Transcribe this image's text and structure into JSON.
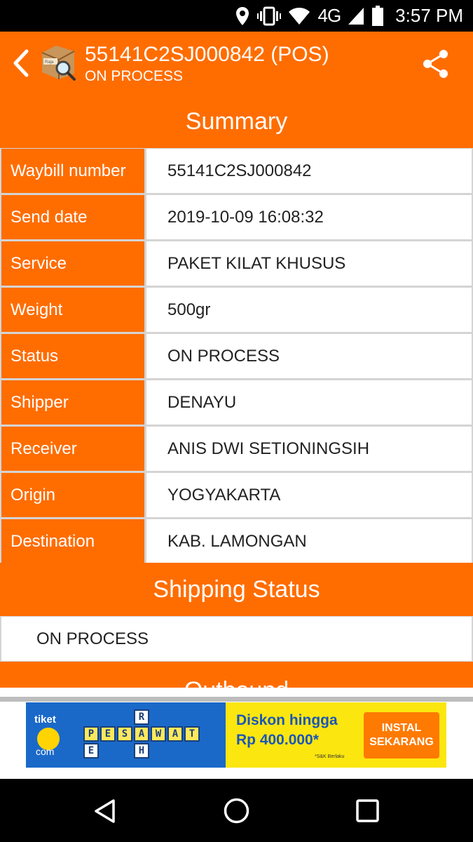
{
  "status_bar": {
    "network": "4G",
    "time": "3:57 PM",
    "icons": [
      "location-icon",
      "vibrate-icon",
      "wifi-icon",
      "signal-icon",
      "battery-icon"
    ]
  },
  "app_bar": {
    "title": "55141C2SJ000842 (POS)",
    "subtitle": "ON PROCESS",
    "back_icon": "chevron-left-icon",
    "app_icon": "parcel-search-icon",
    "app_icon_text": "Raja",
    "share_icon": "share-icon"
  },
  "summary": {
    "heading": "Summary",
    "rows": [
      {
        "label": "Waybill number",
        "value": "55141C2SJ000842"
      },
      {
        "label": "Send date",
        "value": "2019-10-09 16:08:32"
      },
      {
        "label": "Service",
        "value": "PAKET KILAT KHUSUS"
      },
      {
        "label": "Weight",
        "value": "500gr"
      },
      {
        "label": "Status",
        "value": "ON PROCESS"
      },
      {
        "label": "Shipper",
        "value": "DENAYU"
      },
      {
        "label": "Receiver",
        "value": "ANIS DWI SETIONINGSIH"
      },
      {
        "label": "Origin",
        "value": "YOGYAKARTA"
      },
      {
        "label": "Destination",
        "value": "KAB. LAMONGAN"
      }
    ]
  },
  "shipping_status": {
    "heading": "Shipping Status",
    "value": "ON PROCESS"
  },
  "next_section": {
    "heading": "Outbound"
  },
  "ad": {
    "brand_top": "tiket",
    "brand_bottom": "com",
    "crossword_word": "PESAWAT",
    "crossword_extra": [
      "R",
      "E",
      "H"
    ],
    "line1": "Diskon hingga",
    "line2": "Rp 400.000*",
    "note": "*S&K Berlaku",
    "button_line1": "INSTAL",
    "button_line2": "SEKARANG"
  },
  "nav_bar": {
    "icons": [
      "nav-back-icon",
      "nav-home-icon",
      "nav-recents-icon"
    ]
  },
  "colors": {
    "accent": "#ff6d00",
    "ad_blue": "#1a69c9",
    "ad_yellow": "#fbe60f"
  }
}
